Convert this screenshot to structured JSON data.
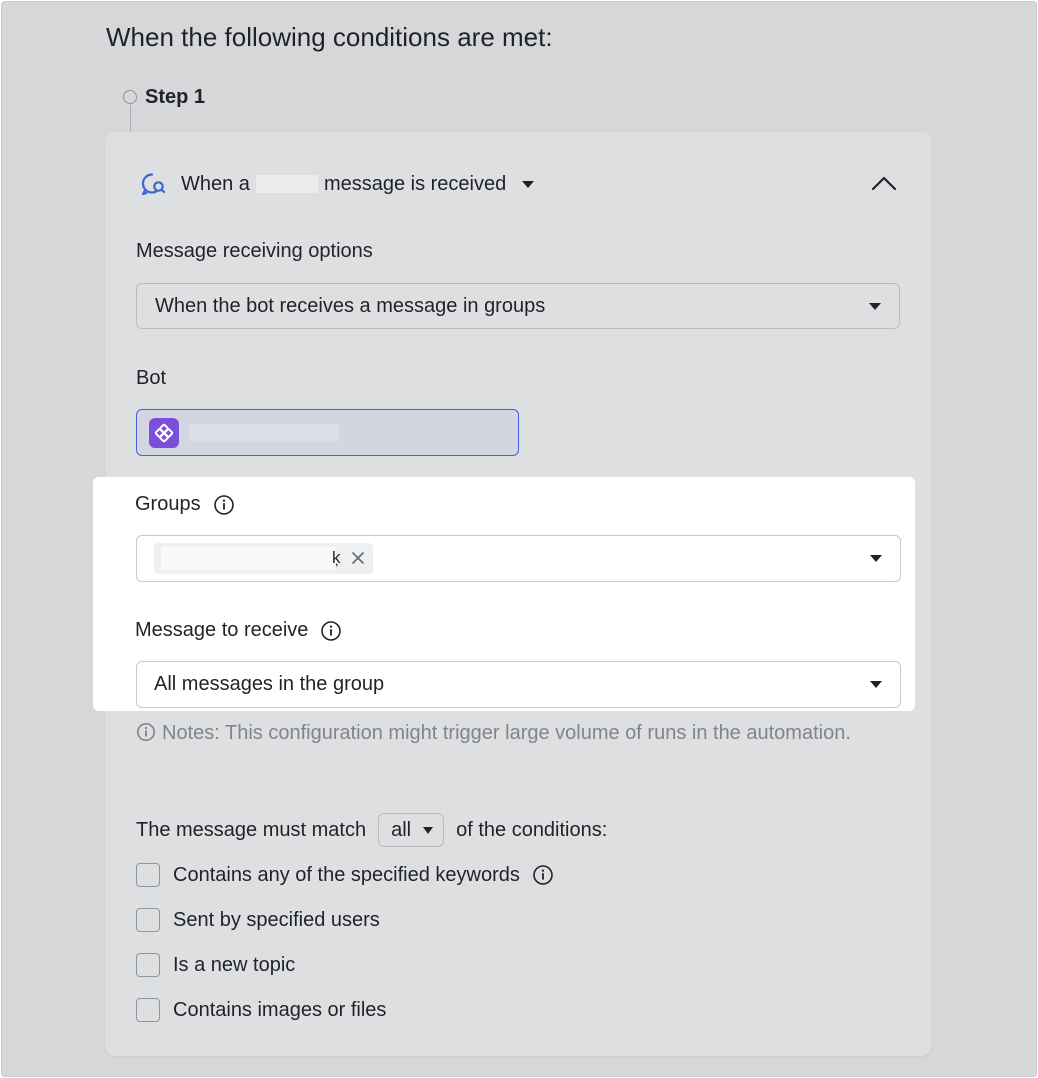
{
  "heading": "When the following conditions are met:",
  "step": {
    "label": "Step 1"
  },
  "trigger": {
    "prefix": "When a",
    "suffix": "message is received",
    "icon": "message-search-icon",
    "collapse_icon": "chevron-up-icon"
  },
  "message_receiving": {
    "label": "Message receiving options",
    "value": "When the bot receives a message in groups"
  },
  "bot": {
    "label": "Bot",
    "avatar_icon": "bot-app-icon",
    "avatar_color": "#7b4fd9"
  },
  "groups": {
    "label": "Groups",
    "chip_suffix": "ķ"
  },
  "message_to_receive": {
    "label": "Message to receive",
    "value": "All messages in the group"
  },
  "notes": {
    "text": "Notes: This configuration might trigger large volume of runs in the automation."
  },
  "match": {
    "prefix": "The message must match",
    "value": "all",
    "suffix": "of the conditions:"
  },
  "conditions": [
    {
      "label": "Contains any of the specified keywords",
      "checked": false,
      "info": true
    },
    {
      "label": "Sent by specified users",
      "checked": false
    },
    {
      "label": "Is a new topic",
      "checked": false
    },
    {
      "label": "Contains images or files",
      "checked": false
    }
  ],
  "colors": {
    "accent_blue": "#3a64d8",
    "bot_purple": "#7b4fd9",
    "note_gray": "#80858c"
  }
}
